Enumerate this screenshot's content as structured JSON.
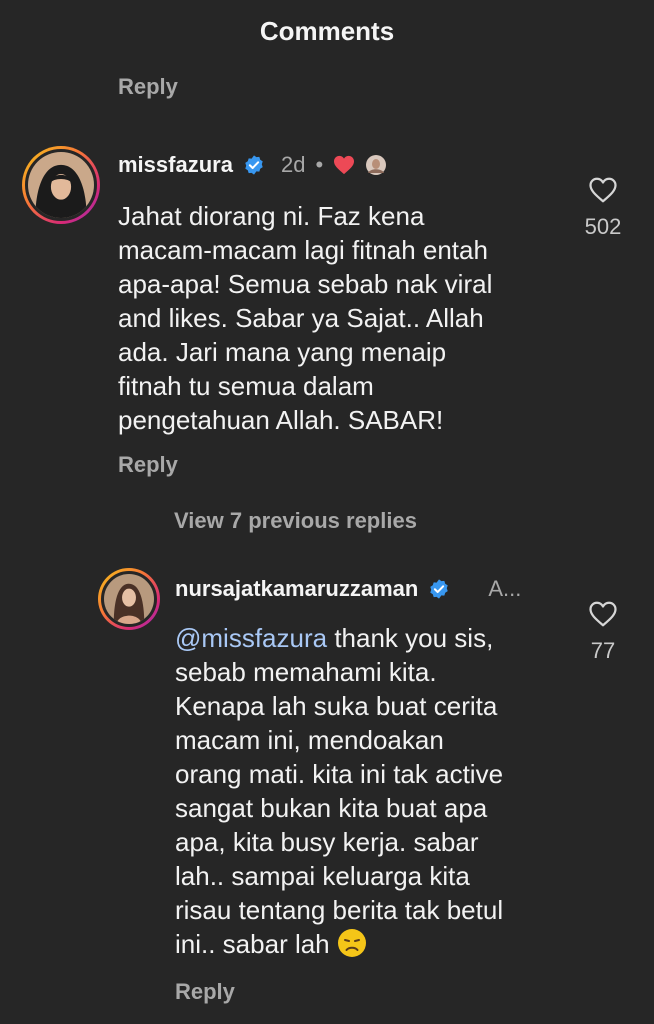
{
  "header": {
    "title": "Comments"
  },
  "top_reply": {
    "label": "Reply"
  },
  "comment1": {
    "username": "missfazura",
    "time": "2d",
    "dot": "•",
    "text": "Jahat diorang ni. Faz kena\nmacam-macam lagi fitnah entah\napa-apa! Semua sebab nak viral\nand likes. Sabar ya Sajat.. Allah\nada. Jari mana yang menaip\nfitnah tu semua dalam\npengetahuan Allah. SABAR!",
    "likes": "502",
    "reply_label": "Reply"
  },
  "view_replies": {
    "label": "View 7 previous replies"
  },
  "comment2": {
    "username": "nursajatkamaruzzaman",
    "time": "A...",
    "mention": "@missfazura",
    "text": " thank you sis,\nsebab memahami kita.\nKenapa lah suka buat cerita\nmacam ini, mendoakan\norang mati. kita ini tak active\nsangat bukan kita buat apa\napa, kita busy kerja. sabar\nlah.. sampai keluarga kita\nrisau tentang berita tak betul\nini.. sabar lah ",
    "likes": "77",
    "reply_label": "Reply"
  },
  "colors": {
    "background": "#262626",
    "verified": "#3897f0",
    "heart": "#ed4956",
    "mention": "#a9c8f5"
  },
  "icons": [
    "verified-badge-icon",
    "red-heart-icon",
    "creator-like-avatar-icon",
    "like-heart-outline-icon",
    "disappointed-face-emoji"
  ]
}
